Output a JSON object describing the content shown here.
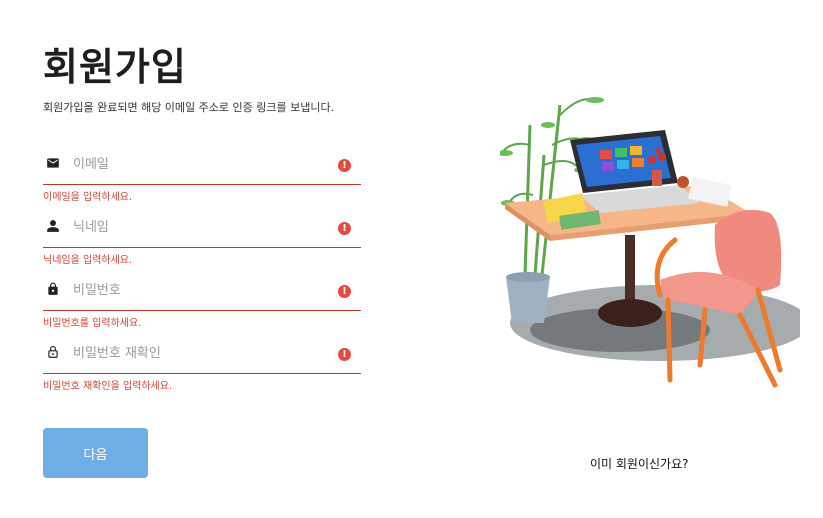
{
  "form": {
    "title": "회원가입",
    "subtitle": "회원가입을 완료되면 해당 이메일 주소로 인증 링크를 보냅니다.",
    "fields": [
      {
        "icon": "mail-icon",
        "placeholder": "이메일",
        "value": "",
        "error": "이메일을 입력하세요."
      },
      {
        "icon": "user-icon",
        "placeholder": "닉네임",
        "value": "",
        "error": "닉네임을 입력하세요."
      },
      {
        "icon": "lock-icon",
        "placeholder": "비밀번호",
        "value": "",
        "error": "비밀번호를 입력하세요."
      },
      {
        "icon": "lock-open-icon",
        "placeholder": "비밀번호 재확인",
        "value": "",
        "error": "비밀번호 재확인을 입력하세요."
      }
    ],
    "error_symbol": "!",
    "next_label": "다음"
  },
  "login_link": "이미 회원이신가요?",
  "colors": {
    "error": "#e34b3f",
    "button": "#6eaee6",
    "chair": "#f08a7e"
  }
}
